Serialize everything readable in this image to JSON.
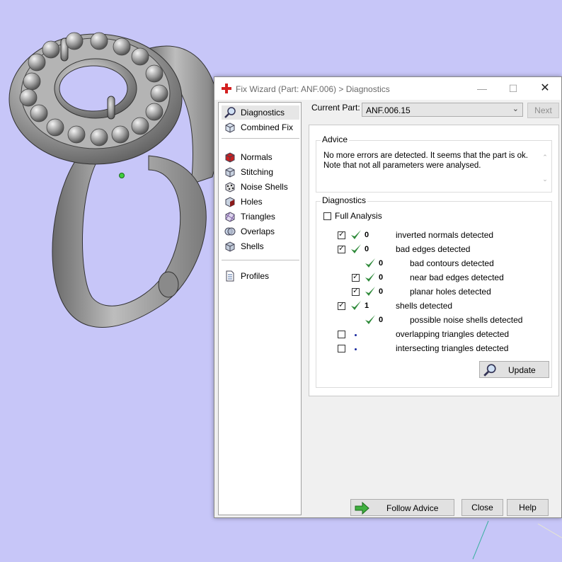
{
  "window": {
    "title": "Fix Wizard (Part: ANF.006) > Diagnostics"
  },
  "nav": {
    "items": [
      {
        "label": "Diagnostics",
        "icon": "magnifier-icon"
      },
      {
        "label": "Combined Fix",
        "icon": "cube-icon"
      },
      {
        "label": "Normals",
        "icon": "normals-cube-icon"
      },
      {
        "label": "Stitching",
        "icon": "stitching-cube-icon"
      },
      {
        "label": "Noise Shells",
        "icon": "noise-shells-icon"
      },
      {
        "label": "Holes",
        "icon": "holes-cube-icon"
      },
      {
        "label": "Triangles",
        "icon": "triangles-icon"
      },
      {
        "label": "Overlaps",
        "icon": "overlaps-icon"
      },
      {
        "label": "Shells",
        "icon": "shells-cube-icon"
      },
      {
        "label": "Profiles",
        "icon": "profiles-document-icon"
      }
    ]
  },
  "part": {
    "label": "Current Part:",
    "value": "ANF.006.15",
    "next_label": "Next"
  },
  "advice": {
    "title": "Advice",
    "line1": "No more errors are detected. It seems that the part is ok.",
    "line2": "Note that not all parameters were analysed."
  },
  "diagnostics": {
    "title": "Diagnostics",
    "full_analysis_label": "Full Analysis",
    "rows": [
      {
        "checkbox": true,
        "status": "ok",
        "count": "0",
        "label": "inverted normals detected"
      },
      {
        "checkbox": true,
        "status": "ok",
        "count": "0",
        "label": "bad edges detected"
      },
      {
        "checkbox": null,
        "status": "ok",
        "count": "0",
        "label": "bad contours detected"
      },
      {
        "checkbox": true,
        "status": "ok",
        "count": "0",
        "label": "near bad edges detected"
      },
      {
        "checkbox": true,
        "status": "ok",
        "count": "0",
        "label": "planar holes detected"
      },
      {
        "checkbox": true,
        "status": "ok",
        "count": "1",
        "label": "shells detected"
      },
      {
        "checkbox": null,
        "status": "ok",
        "count": "0",
        "label": "possible noise shells detected"
      },
      {
        "checkbox": false,
        "status": "none",
        "count": "",
        "label": "overlapping triangles detected"
      },
      {
        "checkbox": false,
        "status": "none",
        "count": "",
        "label": "intersecting triangles detected"
      }
    ],
    "update_label": "Update"
  },
  "buttons": {
    "follow_advice": "Follow Advice",
    "close": "Close",
    "help": "Help"
  },
  "colors": {
    "background": "#c7c6f8",
    "check_green": "#2f8a3a",
    "ring_gray": "#8c8c8c"
  }
}
